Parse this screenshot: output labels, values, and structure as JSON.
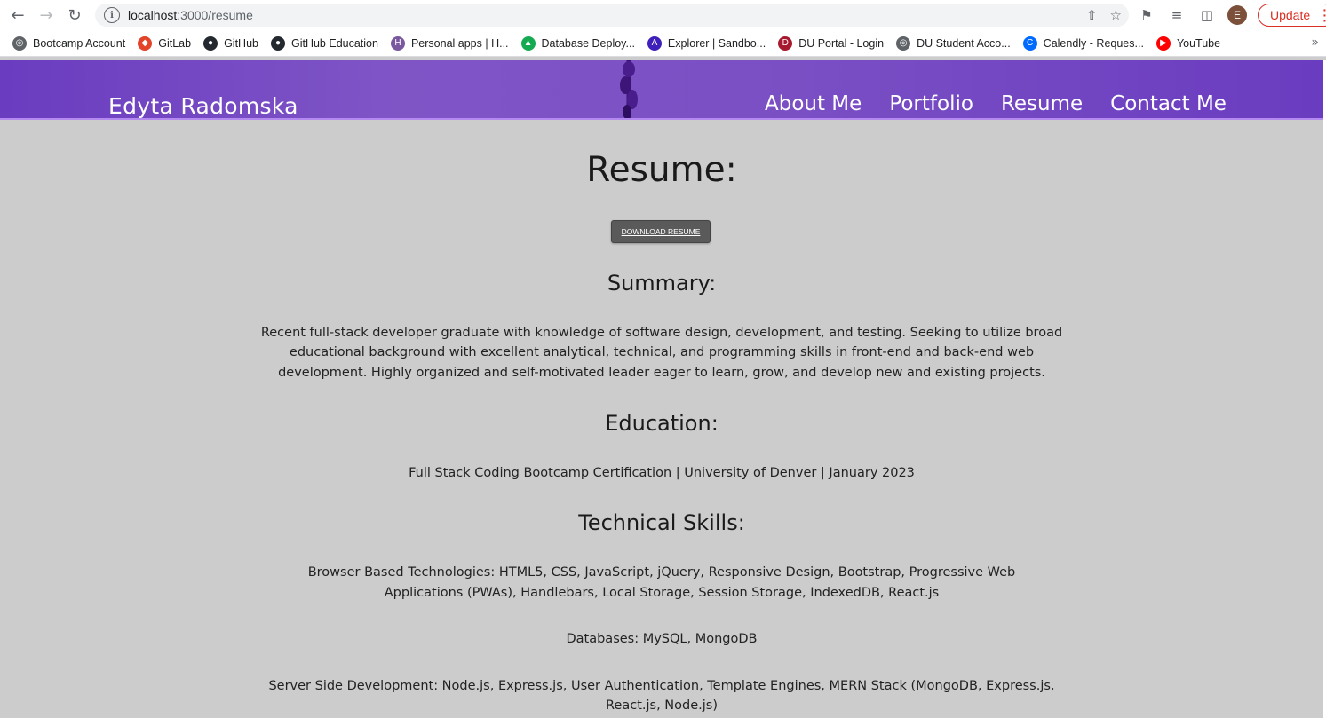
{
  "browser": {
    "url_host": "localhost",
    "url_path": ":3000/resume",
    "update_label": "Update",
    "avatar_letter": "E",
    "bookmarks": [
      {
        "label": "Bootcamp Account",
        "icon": "globe-icon",
        "color": "#5f6368"
      },
      {
        "label": "GitLab",
        "icon": "gitlab-icon",
        "color": "#e24329"
      },
      {
        "label": "GitHub",
        "icon": "github-icon",
        "color": "#24292f"
      },
      {
        "label": "GitHub Education",
        "icon": "github-icon",
        "color": "#24292f"
      },
      {
        "label": "Personal apps | H...",
        "icon": "heroku-icon",
        "color": "#79589f"
      },
      {
        "label": "Database Deploy...",
        "icon": "mongodb-icon",
        "color": "#13aa52"
      },
      {
        "label": "Explorer | Sandbo...",
        "icon": "apollo-icon",
        "color": "#3f20ba"
      },
      {
        "label": "DU Portal - Login",
        "icon": "du-icon",
        "color": "#a6192e"
      },
      {
        "label": "DU Student Acco...",
        "icon": "globe-icon",
        "color": "#5f6368"
      },
      {
        "label": "Calendly - Reques...",
        "icon": "calendly-icon",
        "color": "#006bff"
      },
      {
        "label": "YouTube",
        "icon": "youtube-icon",
        "color": "#ff0000"
      }
    ]
  },
  "header": {
    "brand": "Edyta Radomska",
    "nav": [
      "About Me",
      "Portfolio",
      "Resume",
      "Contact Me"
    ],
    "accent_color": "#7a4fc4"
  },
  "main": {
    "title": "Resume:",
    "download_label": "DOWNLOAD RESUME",
    "summary_heading": "Summary:",
    "summary_line1": "Recent full-stack developer graduate with knowledge of software design, development, and testing. Seeking to utilize broad",
    "summary_line2": "educational background with excellent analytical, technical, and programming skills in front-end and back-end web",
    "summary_line3": "development. Highly organized and self-motivated leader eager to learn, grow, and develop new and existing projects.",
    "education_heading": "Education:",
    "education_text": "Full Stack Coding Bootcamp Certification | University of Denver | January 2023",
    "skills_heading": "Technical Skills:",
    "skills_browser_line1": "Browser Based Technologies: HTML5, CSS, JavaScript, jQuery, Responsive Design, Bootstrap, Progressive Web",
    "skills_browser_line2": "Applications (PWAs), Handlebars, Local Storage, Session Storage, IndexedDB, React.js",
    "skills_databases": "Databases: MySQL, MongoDB",
    "skills_server_line1": "Server Side Development: Node.js, Express.js, User Authentication, Template Engines, MERN Stack (MongoDB, Express.js,",
    "skills_server_line2": "React.js, Node.js)"
  }
}
